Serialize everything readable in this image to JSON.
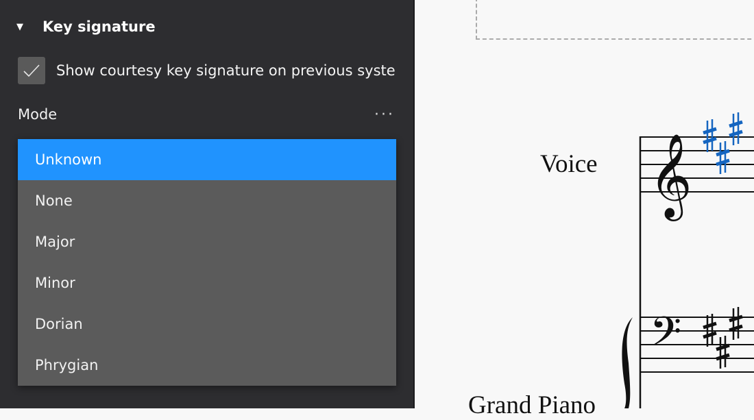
{
  "inspector": {
    "section_title": "Key signature",
    "courtesy_checkbox": {
      "label": "Show courtesy key signature on previous syste",
      "checked": true
    },
    "mode_label": "Mode",
    "more_label": "···",
    "mode_options": [
      {
        "label": "Unknown",
        "selected": true
      },
      {
        "label": "None",
        "selected": false
      },
      {
        "label": "Major",
        "selected": false
      },
      {
        "label": "Minor",
        "selected": false
      },
      {
        "label": "Dorian",
        "selected": false
      },
      {
        "label": "Phrygian",
        "selected": false
      }
    ]
  },
  "score": {
    "instrument_voice": "Voice",
    "instrument_piano": "Grand Piano",
    "key_signature_accidentals": 3,
    "selection_color": "#1565c0"
  }
}
